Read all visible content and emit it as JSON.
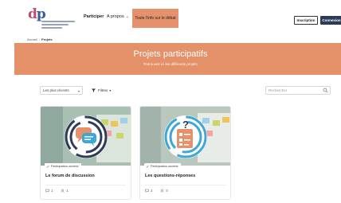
{
  "header": {
    "logo": {
      "mark": "dp",
      "tagline_lines": 3
    },
    "nav": {
      "participer": "Participer",
      "apropos": "A propos"
    },
    "cta": "Toute l'info sur le débat",
    "inscription": "Inscription",
    "connexion": "Connexion"
  },
  "breadcrumb": {
    "home": "Accueil",
    "separator": "/",
    "current": "Projets"
  },
  "banner": {
    "title": "Projets participatifs",
    "subtitle": "Retrouvez ici les différents projets",
    "color": "#e49068"
  },
  "filters": {
    "sort_value": "Les plus récents",
    "filter_label": "Filtres",
    "search_placeholder": "Rechercher"
  },
  "cards": [
    {
      "status": "Participation ouverte",
      "title": "Le forum de discussion",
      "comments": "1",
      "participants": "1",
      "icon": "chat-bubbles-icon"
    },
    {
      "status": "Participation ouverte",
      "title": "Les questions-réponses",
      "comments": "3",
      "participants": "0",
      "icon": "question-clipboard-icon"
    }
  ],
  "colors": {
    "accent": "#e5916b",
    "navy": "#2d3b59",
    "status_green": "#5aa65a"
  }
}
